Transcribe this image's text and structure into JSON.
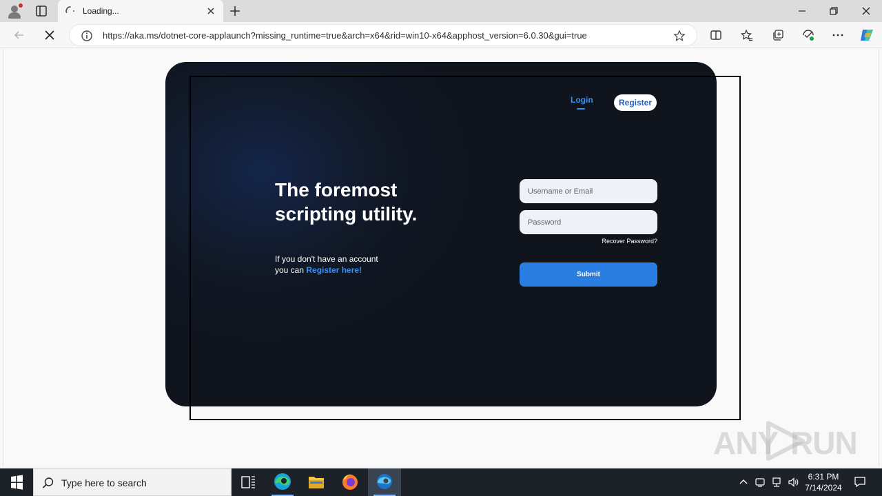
{
  "browser": {
    "tab_title": "Loading...",
    "url": "https://aka.ms/dotnet-core-applaunch?missing_runtime=true&arch=x64&rid=win10-x64&apphost_version=6.0.30&gui=true"
  },
  "page": {
    "nav": {
      "login_label": "Login",
      "register_label": "Register"
    },
    "headline": "The foremost scripting utility.",
    "subtext_line1": "If you don't have an account",
    "subtext_prefix": "you can",
    "register_link": "Register here!",
    "username_placeholder": "Username or Email",
    "password_placeholder": "Password",
    "recover_label": "Recover Password?",
    "submit_label": "Submit"
  },
  "watermark": {
    "left": "ANY",
    "right": "RUN"
  },
  "taskbar": {
    "search_placeholder": "Type here to search",
    "time": "6:31 PM",
    "date": "7/14/2024"
  },
  "colors": {
    "accent": "#2a7de1",
    "link": "#3a8ef0",
    "card_bg": "#111826",
    "taskbar_bg": "#1d2229"
  }
}
